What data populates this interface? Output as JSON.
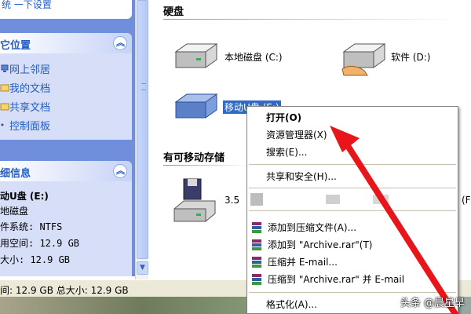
{
  "taskpane": {
    "top_fragment": "统 一下设置",
    "other_places": {
      "title": "它位置",
      "links": [
        {
          "label": "网上邻居",
          "icon": "network-icon"
        },
        {
          "label": "我的文档",
          "icon": "documents-folder-icon"
        },
        {
          "label": "共享文档",
          "icon": "shared-folder-icon"
        },
        {
          "label": "控制面板",
          "icon": "control-panel-icon"
        }
      ]
    },
    "details": {
      "title": "细信息",
      "name": "动U盘 (E:)",
      "type": "地磁盘",
      "filesystem": "件系统: NTFS",
      "free": "用空间: 12.9 GB",
      "total": "大小: 12.9 GB"
    }
  },
  "main": {
    "hard_disks_title": "硬盘",
    "drives": [
      {
        "label": "本地磁盘 (C:)",
        "icon": "hard-drive-icon"
      },
      {
        "label": "软件 (D:)",
        "icon": "shared-hard-drive-icon"
      },
      {
        "label": "移动U盘 (E:)",
        "icon": "usb-drive-icon"
      }
    ],
    "removable_title": "有可移动存储",
    "floppy_label": "3.5",
    "floppy_trailing": "(F:"
  },
  "statusbar": {
    "text": "间: 12.9 GB 总大小: 12.9 GB"
  },
  "context_menu": {
    "items": [
      {
        "label": "打开(O)",
        "bold": true
      },
      {
        "label": "资源管理器(X)"
      },
      {
        "label": "搜索(E)..."
      },
      {
        "label": "共享和安全(H)..."
      },
      {
        "label": "添加到压缩文件(A)...",
        "icon": "winrar-icon"
      },
      {
        "label": "添加到 \"Archive.rar\"(T)",
        "icon": "winrar-icon"
      },
      {
        "label": "压缩并 E-mail...",
        "icon": "winrar-icon"
      },
      {
        "label": "压缩到 \"Archive.rar\" 并 E-mail",
        "icon": "winrar-icon"
      },
      {
        "label": "格式化(A)..."
      }
    ]
  },
  "watermark": "头条 @晨星早",
  "colors": {
    "taskpane_bg": "#6f8fdc",
    "link": "#215dc6",
    "arrow": "#e8161b",
    "selection": "#316ac5"
  }
}
